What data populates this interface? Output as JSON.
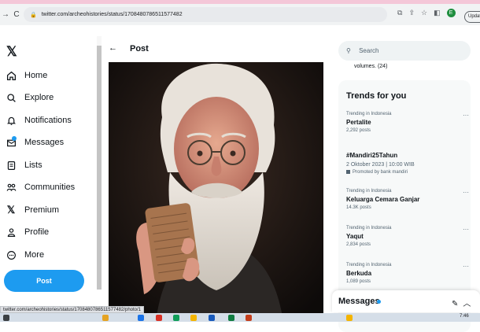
{
  "browser": {
    "url": "twitter.com/archeohistories/status/1708480786511577482",
    "update_label": "Update",
    "profile_initial": "E"
  },
  "sidebar": {
    "logo": "𝕏",
    "items": [
      {
        "label": "Home"
      },
      {
        "label": "Explore"
      },
      {
        "label": "Notifications"
      },
      {
        "label": "Messages"
      },
      {
        "label": "Lists"
      },
      {
        "label": "Communities"
      },
      {
        "label": "Premium"
      },
      {
        "label": "Profile"
      },
      {
        "label": "More"
      }
    ],
    "post_button": "Post"
  },
  "main": {
    "back": "←",
    "title": "Post"
  },
  "right": {
    "search_placeholder": "Search",
    "volumes_text": "volumes. (24)",
    "trends_title": "Trends for you",
    "trends": [
      {
        "meta": "Trending in Indonesia",
        "name": "Pertalite",
        "count": "2,292 posts"
      },
      {
        "name": "#Mandiri25Tahun",
        "date": "2 Oktober 2023 | 10:00 WIB",
        "promo": "Promoted by bank mandiri"
      },
      {
        "meta": "Trending in Indonesia",
        "name": "Keluarga Cemara Ganjar",
        "count": "14.3K posts"
      },
      {
        "meta": "Trending in Indonesia",
        "name": "Yaqut",
        "count": "2,834 posts"
      },
      {
        "meta": "Trending in Indonesia",
        "name": "Berkuda",
        "count": "1,089 posts"
      }
    ],
    "more_glyph": "···"
  },
  "messages": {
    "label": "Messages"
  },
  "status_url": "twitter.com/archeohistories/status/1708480786511577482/photo/1",
  "taskbar": {
    "time": "7:46"
  }
}
